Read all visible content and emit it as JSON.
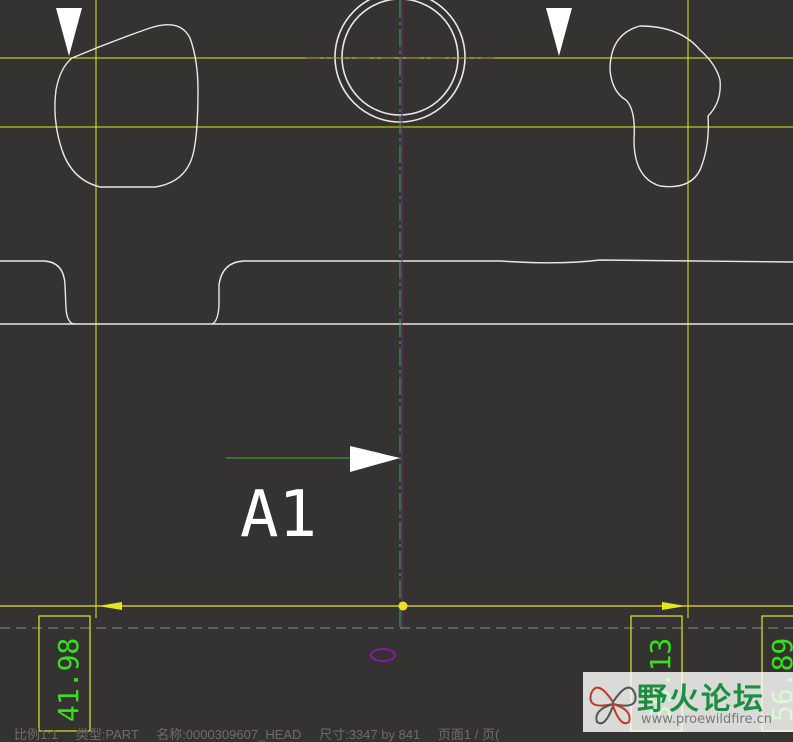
{
  "drawing": {
    "section_label": "A1",
    "dimensions": {
      "left_value": "41.98",
      "middle_value": "39.13",
      "right_value": "56.89"
    },
    "colors": {
      "background": "#353331",
      "geometry": "#e8e8e8",
      "construction_line": "#e6e61e",
      "dimension_text": "#35e01c",
      "centerline": "#8a18a8",
      "arrow_line": "#2fb82f"
    }
  },
  "statusbar": {
    "scale": "比例1:1",
    "type": "类型:PART",
    "name": "名称:0000309607_HEAD",
    "size": "尺寸:3347 by 841",
    "page": "页面1 / 页(",
    "trailing": "."
  },
  "watermark": {
    "title": "野火论坛",
    "url": "www.proewildfire.cn"
  }
}
